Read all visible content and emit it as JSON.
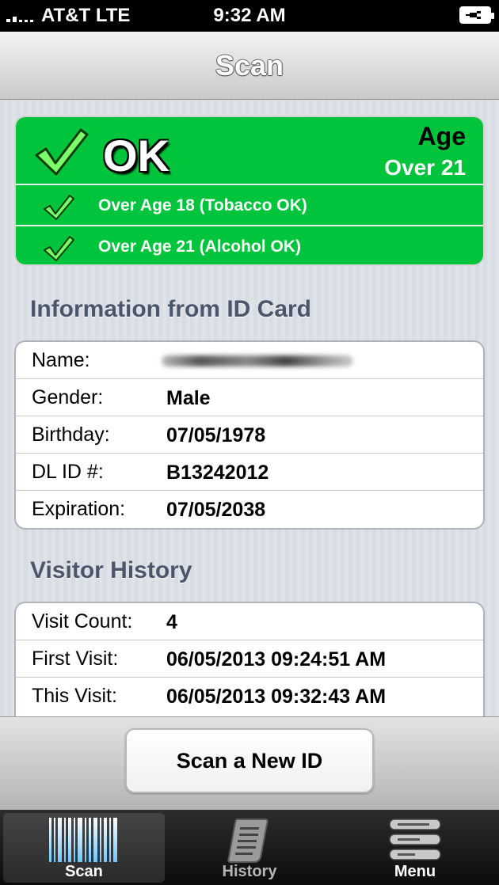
{
  "status_bar": {
    "carrier": "AT&T  LTE",
    "time": "9:32 AM"
  },
  "nav": {
    "title": "Scan"
  },
  "result": {
    "status": "OK",
    "age_label": "Age",
    "age_value": "Over 21",
    "checks": [
      {
        "label": "Over Age 18 (Tobacco OK)"
      },
      {
        "label": "Over Age 21 (Alcohol OK)"
      }
    ],
    "color": "#00c43b"
  },
  "id_card": {
    "title": "Information from ID Card",
    "rows": [
      {
        "label": "Name:",
        "value": ""
      },
      {
        "label": "Gender:",
        "value": "Male"
      },
      {
        "label": "Birthday:",
        "value": "07/05/1978"
      },
      {
        "label": "DL ID #:",
        "value": "B13242012"
      },
      {
        "label": "Expiration:",
        "value": "07/05/2038"
      }
    ]
  },
  "visitor_history": {
    "title": "Visitor History",
    "rows": [
      {
        "label": "Visit Count:",
        "value": "4"
      },
      {
        "label": "First Visit:",
        "value": "06/05/2013 09:24:51 AM"
      },
      {
        "label": "This Visit:",
        "value": "06/05/2013 09:32:43 AM"
      }
    ]
  },
  "actions": {
    "scan_new_label": "Scan a New ID"
  },
  "tabs": [
    {
      "label": "Scan",
      "icon": "barcode-icon",
      "selected": true
    },
    {
      "label": "History",
      "icon": "scroll-icon",
      "selected": false
    },
    {
      "label": "Menu",
      "icon": "menu-list-icon",
      "selected": false
    }
  ]
}
